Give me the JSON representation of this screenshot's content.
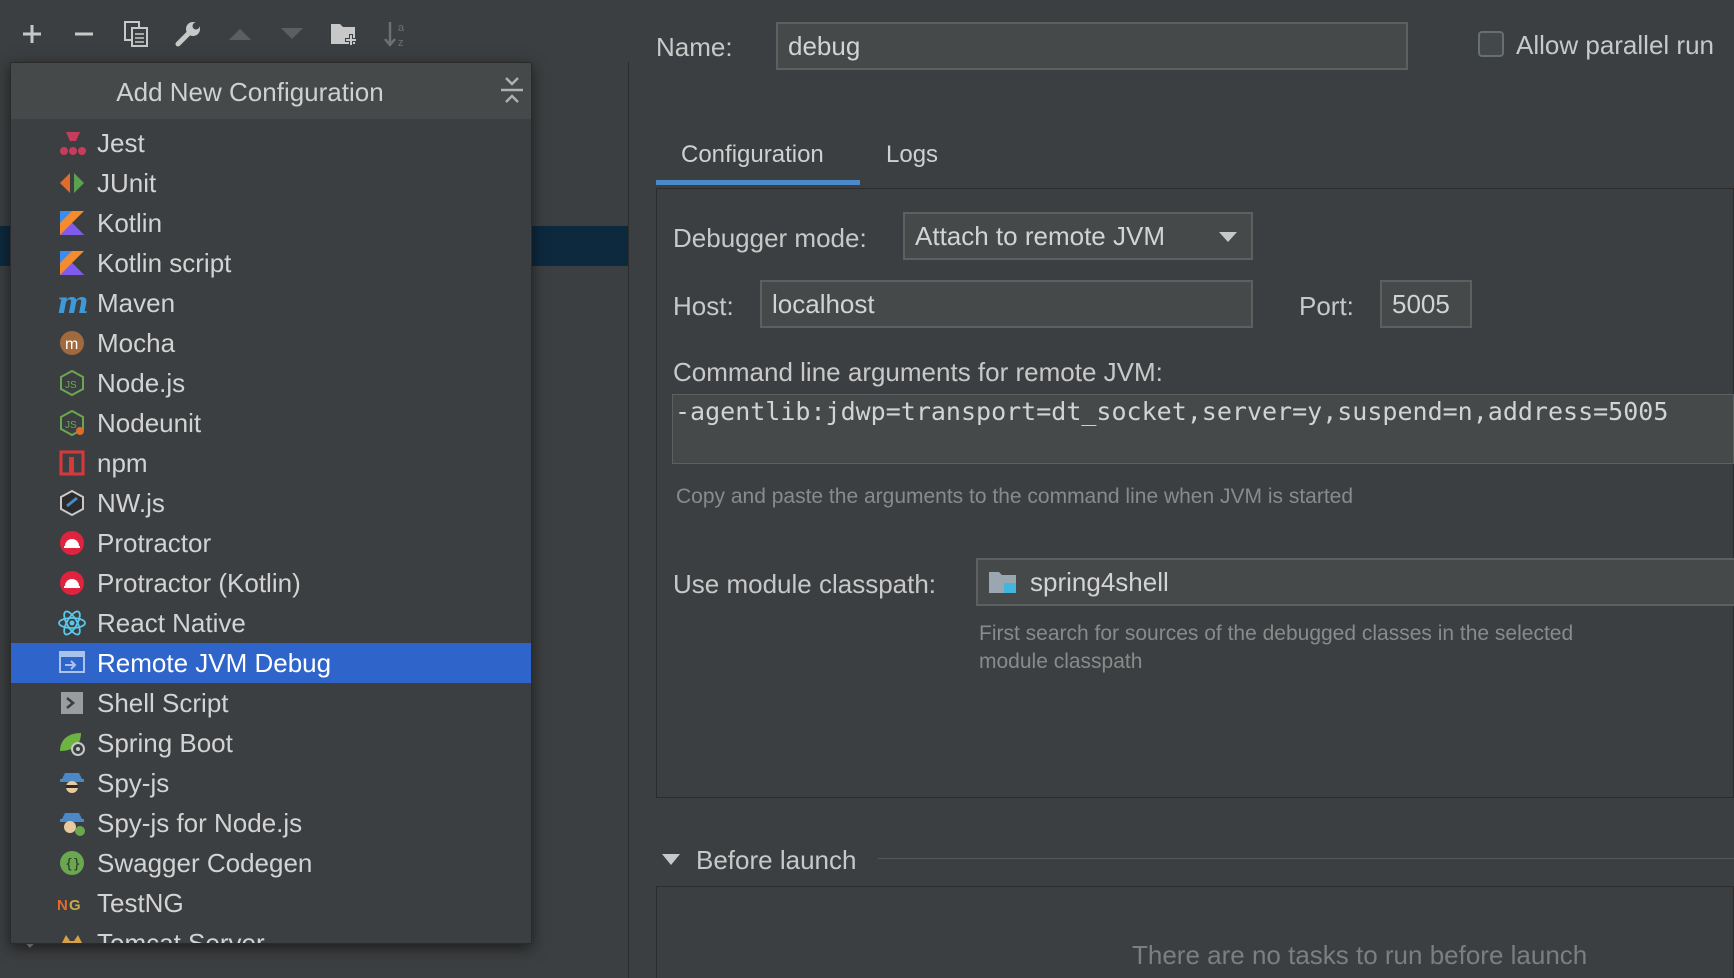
{
  "toolbar": {
    "icons": [
      "add-icon",
      "remove-icon",
      "copy-icon",
      "wrench-icon",
      "move-up-icon",
      "move-down-icon",
      "new-folder-icon",
      "sort-icon"
    ]
  },
  "popup": {
    "title": "Add New Configuration",
    "items": [
      {
        "label": "Jest",
        "icon": "jest-icon"
      },
      {
        "label": "JUnit",
        "icon": "junit-icon"
      },
      {
        "label": "Kotlin",
        "icon": "kotlin-icon"
      },
      {
        "label": "Kotlin script",
        "icon": "kotlin-script-icon"
      },
      {
        "label": "Maven",
        "icon": "maven-icon"
      },
      {
        "label": "Mocha",
        "icon": "mocha-icon"
      },
      {
        "label": "Node.js",
        "icon": "nodejs-icon"
      },
      {
        "label": "Nodeunit",
        "icon": "nodeunit-icon"
      },
      {
        "label": "npm",
        "icon": "npm-icon"
      },
      {
        "label": "NW.js",
        "icon": "nwjs-icon"
      },
      {
        "label": "Protractor",
        "icon": "protractor-icon"
      },
      {
        "label": "Protractor (Kotlin)",
        "icon": "protractor-kotlin-icon"
      },
      {
        "label": "React Native",
        "icon": "react-native-icon"
      },
      {
        "label": "Remote JVM Debug",
        "icon": "remote-jvm-debug-icon",
        "selected": true
      },
      {
        "label": "Shell Script",
        "icon": "shell-script-icon"
      },
      {
        "label": "Spring Boot",
        "icon": "spring-boot-icon"
      },
      {
        "label": "Spy-js",
        "icon": "spy-js-icon"
      },
      {
        "label": "Spy-js for Node.js",
        "icon": "spy-js-node-icon"
      },
      {
        "label": "Swagger Codegen",
        "icon": "swagger-codegen-icon"
      },
      {
        "label": "TestNG",
        "icon": "testng-icon"
      },
      {
        "label": "Tomcat Server",
        "icon": "tomcat-icon"
      }
    ]
  },
  "form": {
    "name_label": "Name:",
    "name_value": "debug",
    "allow_parallel_label": "Allow parallel run",
    "tabs": [
      {
        "label": "Configuration",
        "active": true
      },
      {
        "label": "Logs",
        "active": false
      }
    ],
    "debugger_mode_label": "Debugger mode:",
    "debugger_mode_value": "Attach to remote JVM",
    "host_label": "Host:",
    "host_value": "localhost",
    "port_label": "Port:",
    "port_value": "5005",
    "cmd_label": "Command line arguments for remote JVM:",
    "cmd_value": "-agentlib:jdwp=transport=dt_socket,server=y,suspend=n,address=5005",
    "cmd_hint": "Copy and paste the arguments to the command line when JVM is started",
    "module_label": "Use module classpath:",
    "module_value": "spring4shell",
    "module_hint_1": "First search for sources of the debugged classes in the selected",
    "module_hint_2": "module classpath",
    "before_launch_label": "Before launch",
    "before_launch_empty": "There are no tasks to run before launch"
  },
  "colors": {
    "background": "#3c3f41",
    "selection": "#2f65ca",
    "tab_underline": "#4a88c7"
  }
}
